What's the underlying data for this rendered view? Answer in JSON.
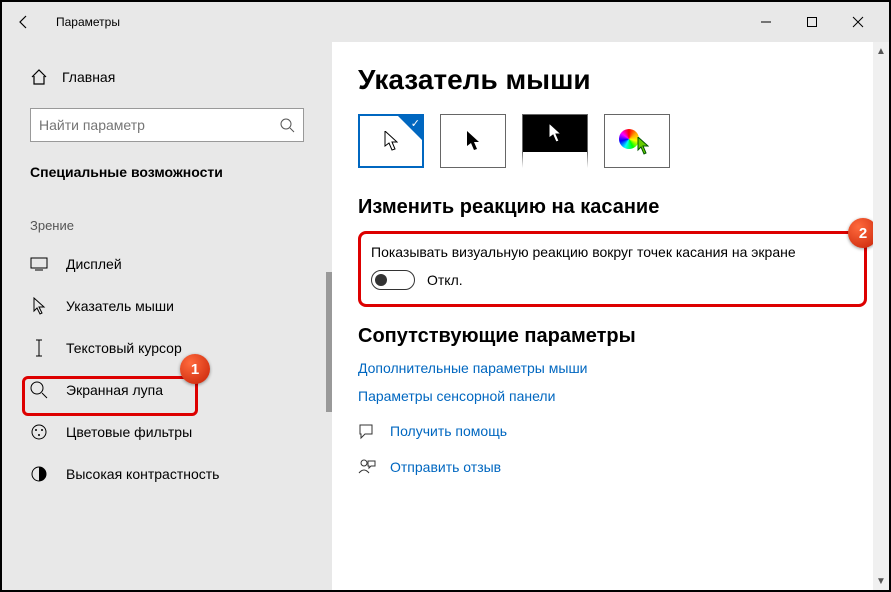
{
  "window": {
    "title": "Параметры"
  },
  "sidebar": {
    "home_label": "Главная",
    "search_placeholder": "Найти параметр",
    "section_title": "Специальные возможности",
    "group_label": "Зрение",
    "items": [
      {
        "label": "Дисплей"
      },
      {
        "label": "Указатель мыши"
      },
      {
        "label": "Текстовый курсор"
      },
      {
        "label": "Экранная лупа"
      },
      {
        "label": "Цветовые фильтры"
      },
      {
        "label": "Высокая контрастность"
      }
    ]
  },
  "main": {
    "heading": "Указатель мыши",
    "touch_section_title": "Изменить реакцию на касание",
    "touch_desc": "Показывать визуальную реакцию вокруг точек касания на экране",
    "toggle_state": "Откл.",
    "related_title": "Сопутствующие параметры",
    "link_mouse": "Дополнительные параметры мыши",
    "link_touchpad": "Параметры сенсорной панели",
    "help": "Получить помощь",
    "feedback": "Отправить отзыв"
  },
  "badges": {
    "one": "1",
    "two": "2"
  }
}
